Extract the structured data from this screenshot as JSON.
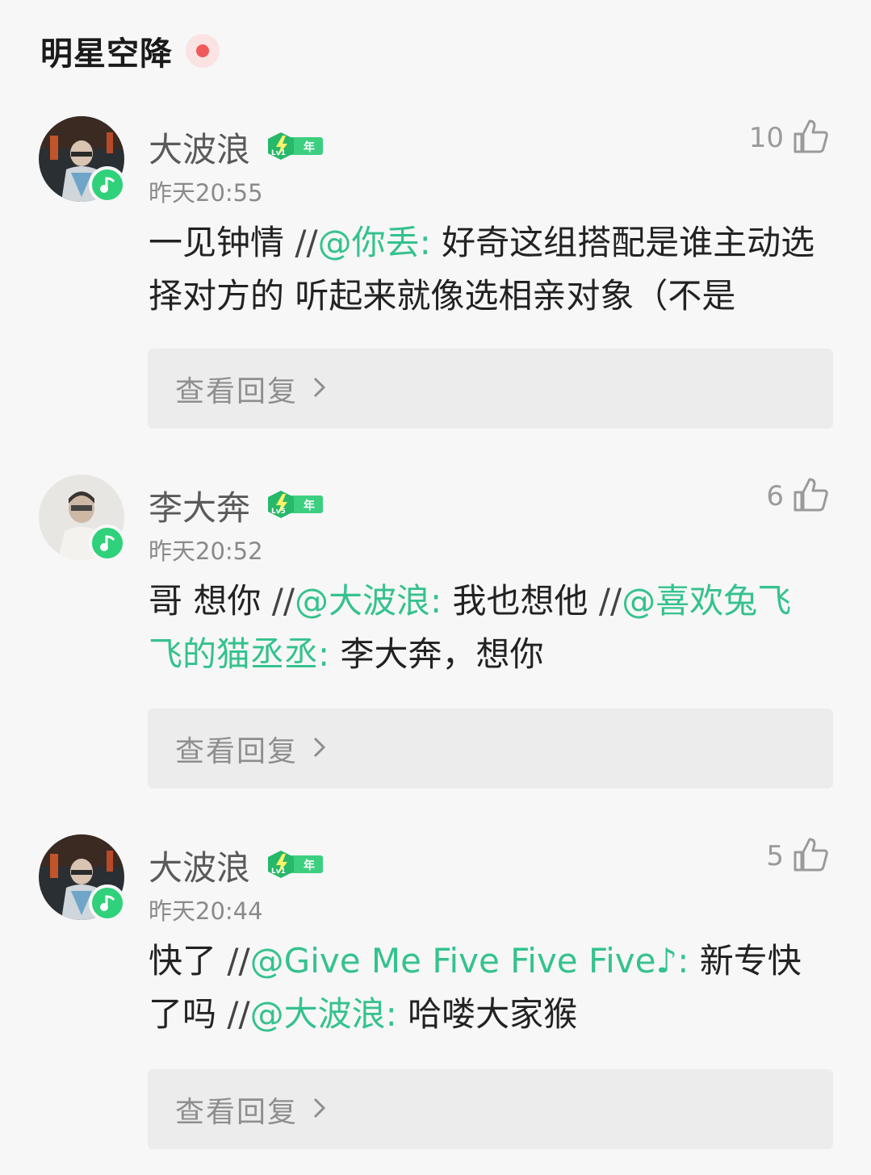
{
  "header": {
    "title": "明星空降"
  },
  "comments": [
    {
      "username": "大波浪",
      "level": "Lv1",
      "badge_text": "年",
      "likes": "10",
      "time": "昨天20:55",
      "segments": [
        {
          "t": "一见钟情 ",
          "k": "text"
        },
        {
          "t": "//",
          "k": "slash"
        },
        {
          "t": "@你丢:",
          "k": "mention"
        },
        {
          "t": " 好奇这组搭配是谁主动选择对方的 听起来就像选相亲对象（不是",
          "k": "text"
        }
      ],
      "reply_label": "查看回复"
    },
    {
      "username": "李大奔",
      "level": "Lv5",
      "badge_text": "年",
      "likes": "6",
      "time": "昨天20:52",
      "segments": [
        {
          "t": "哥 想你 ",
          "k": "text"
        },
        {
          "t": "//",
          "k": "slash"
        },
        {
          "t": "@大波浪:",
          "k": "mention"
        },
        {
          "t": " 我也想他 ",
          "k": "text"
        },
        {
          "t": "//",
          "k": "slash"
        },
        {
          "t": "@喜欢兔飞飞的猫丞丞:",
          "k": "mention"
        },
        {
          "t": " 李大奔，想你",
          "k": "text"
        }
      ],
      "reply_label": "查看回复"
    },
    {
      "username": "大波浪",
      "level": "Lv1",
      "badge_text": "年",
      "likes": "5",
      "time": "昨天20:44",
      "segments": [
        {
          "t": "快了 ",
          "k": "text"
        },
        {
          "t": "//",
          "k": "slash"
        },
        {
          "t": "@Give Me Five Five Five♪:",
          "k": "mention"
        },
        {
          "t": " 新专快了吗 ",
          "k": "text"
        },
        {
          "t": "//",
          "k": "slash"
        },
        {
          "t": "@大波浪:",
          "k": "mention"
        },
        {
          "t": " 哈喽大家猴",
          "k": "text"
        }
      ],
      "reply_label": "查看回复"
    }
  ],
  "colors": {
    "accent": "#35c28e",
    "live": "#f05a5a",
    "badge_green": "#2fd17a"
  },
  "icons": [
    "like-icon",
    "chevron-right-icon",
    "music-note-icon",
    "level-badge-icon"
  ]
}
